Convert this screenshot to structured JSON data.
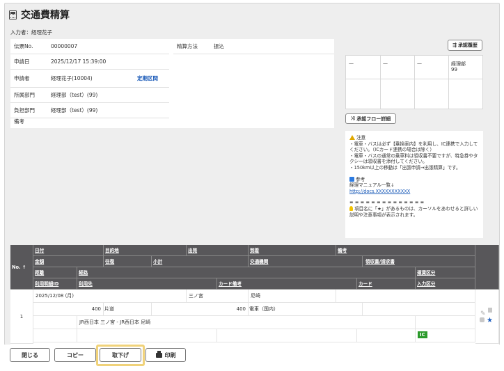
{
  "page": {
    "title": "交通費精算",
    "entered_by": "入力者：経理花子"
  },
  "info": {
    "slip_no_label": "伝票No.",
    "slip_no": "00000007",
    "method_label": "精算方法",
    "method": "振込",
    "apply_date_label": "申請日",
    "apply_date": "2025/12/17 15:39:00",
    "applicant_label": "申請者",
    "applicant": "経理花子(10004)",
    "commute_link": "定期区間",
    "dept_label": "所属部門",
    "dept": "経理部（test）(99)",
    "charge_label": "負担部門",
    "charge": "経理部（test）(99)",
    "remarks_label": "備考"
  },
  "approval": {
    "history_button": "承認履歴",
    "cells": [
      "—",
      "—",
      "—",
      "経理部",
      "99"
    ],
    "flow_button": "承認フロー詳細"
  },
  "notice": {
    "caution_title": "注意",
    "caution_lines": "・電車・バスは必ず【乗換案内】を利用し、IC連携で入力してください。（ICカード連携の場合は除く）\n・電車・バスの通常の乗車料は領収書不要ですが、特急券やタクシーは領収書を添付してください。\n・150km以上の移動は「出張申請→出張精算」です。",
    "ref_title": "参考",
    "ref_text": "経理マニュアル一覧↓",
    "ref_link": "http://docs.XXXXXXXXXXX",
    "separator": "= = = = = = = = = = = = = =",
    "tip": "項目名に「★」があるものは、カーソルをあわせると詳しい説明や注意事項が表示されます。"
  },
  "table": {
    "headers": {
      "no": "No. ↑",
      "date": "日付",
      "purpose": "目的地",
      "depart": "出発",
      "arrive": "到着",
      "remark": "備考",
      "amount": "金額",
      "round": "往復",
      "subtotal": "小計",
      "transport": "交通機関",
      "receipt": "領収書/請求書",
      "distance": "距離",
      "route": "経路",
      "ride_type": "運賃区分",
      "detail_id": "利用明細ID",
      "user": "利用先",
      "card_remark": "カード備考",
      "card": "カード",
      "input_type": "入力区分"
    },
    "row": {
      "no": "1",
      "date": "2025/12/08 (月)",
      "depart": "三ノ宮",
      "arrive": "尼崎",
      "amount": "400",
      "round": "片道",
      "subtotal": "400",
      "transport": "電車（国内）",
      "route": "JR西日本 三ノ宮 - JR西日本 尼崎",
      "ic": "IC"
    }
  },
  "footer": {
    "close": "閉じる",
    "copy": "コピー",
    "withdraw": "取下げ",
    "print": "印刷"
  }
}
